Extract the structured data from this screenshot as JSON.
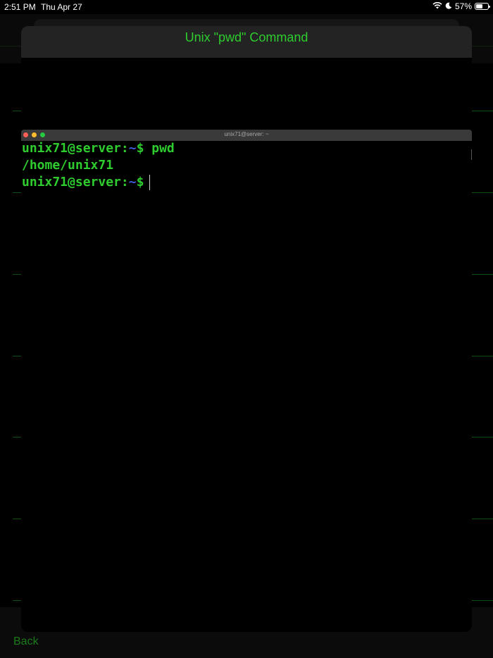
{
  "status_bar": {
    "time": "2:51 PM",
    "date": "Thu Apr 27",
    "battery": "57%",
    "battery_level": 0.57
  },
  "modal": {
    "title": "Unix \"pwd\" Command"
  },
  "terminal": {
    "window_title": "unix71@server: ~",
    "lines": [
      {
        "prompt": "unix71@server:",
        "tilde": "~",
        "suffix": "$ pwd"
      },
      {
        "output": "/home/unix71"
      },
      {
        "prompt": "unix71@server:",
        "tilde": "~",
        "suffix": "$"
      }
    ]
  },
  "nav": {
    "back_label": "Back"
  },
  "colors": {
    "accent_green": "#2ecc2e",
    "prompt_tilde_blue": "#3b5bd8"
  }
}
